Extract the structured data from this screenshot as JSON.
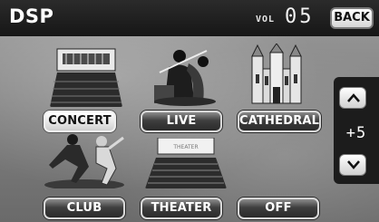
{
  "header": {
    "title": "DSP",
    "volume_label": "VOL",
    "volume_value": "05",
    "back_label": "BACK"
  },
  "modes": [
    {
      "label": "CONCERT",
      "icon": "concert-hall-picture",
      "selected": true
    },
    {
      "label": "LIVE",
      "icon": "live-musicians-picture",
      "selected": false
    },
    {
      "label": "CATHEDRAL",
      "icon": "cathedral-picture",
      "selected": false
    },
    {
      "label": "CLUB",
      "icon": "club-dancers-picture",
      "selected": false
    },
    {
      "label": "THEATER",
      "icon": "theater-seats-picture",
      "selected": false
    },
    {
      "label": "OFF",
      "icon": null,
      "selected": false
    }
  ],
  "level_control": {
    "value": "+5",
    "up_icon": "chevron-up-icon",
    "down_icon": "chevron-down-icon"
  },
  "theater_sign_text": "THEATER",
  "colors": {
    "title_bar": "#1a1a1a",
    "button_dark": "#2a2a2a",
    "button_selected": "#ffffff",
    "background": "#8a8a8a"
  }
}
